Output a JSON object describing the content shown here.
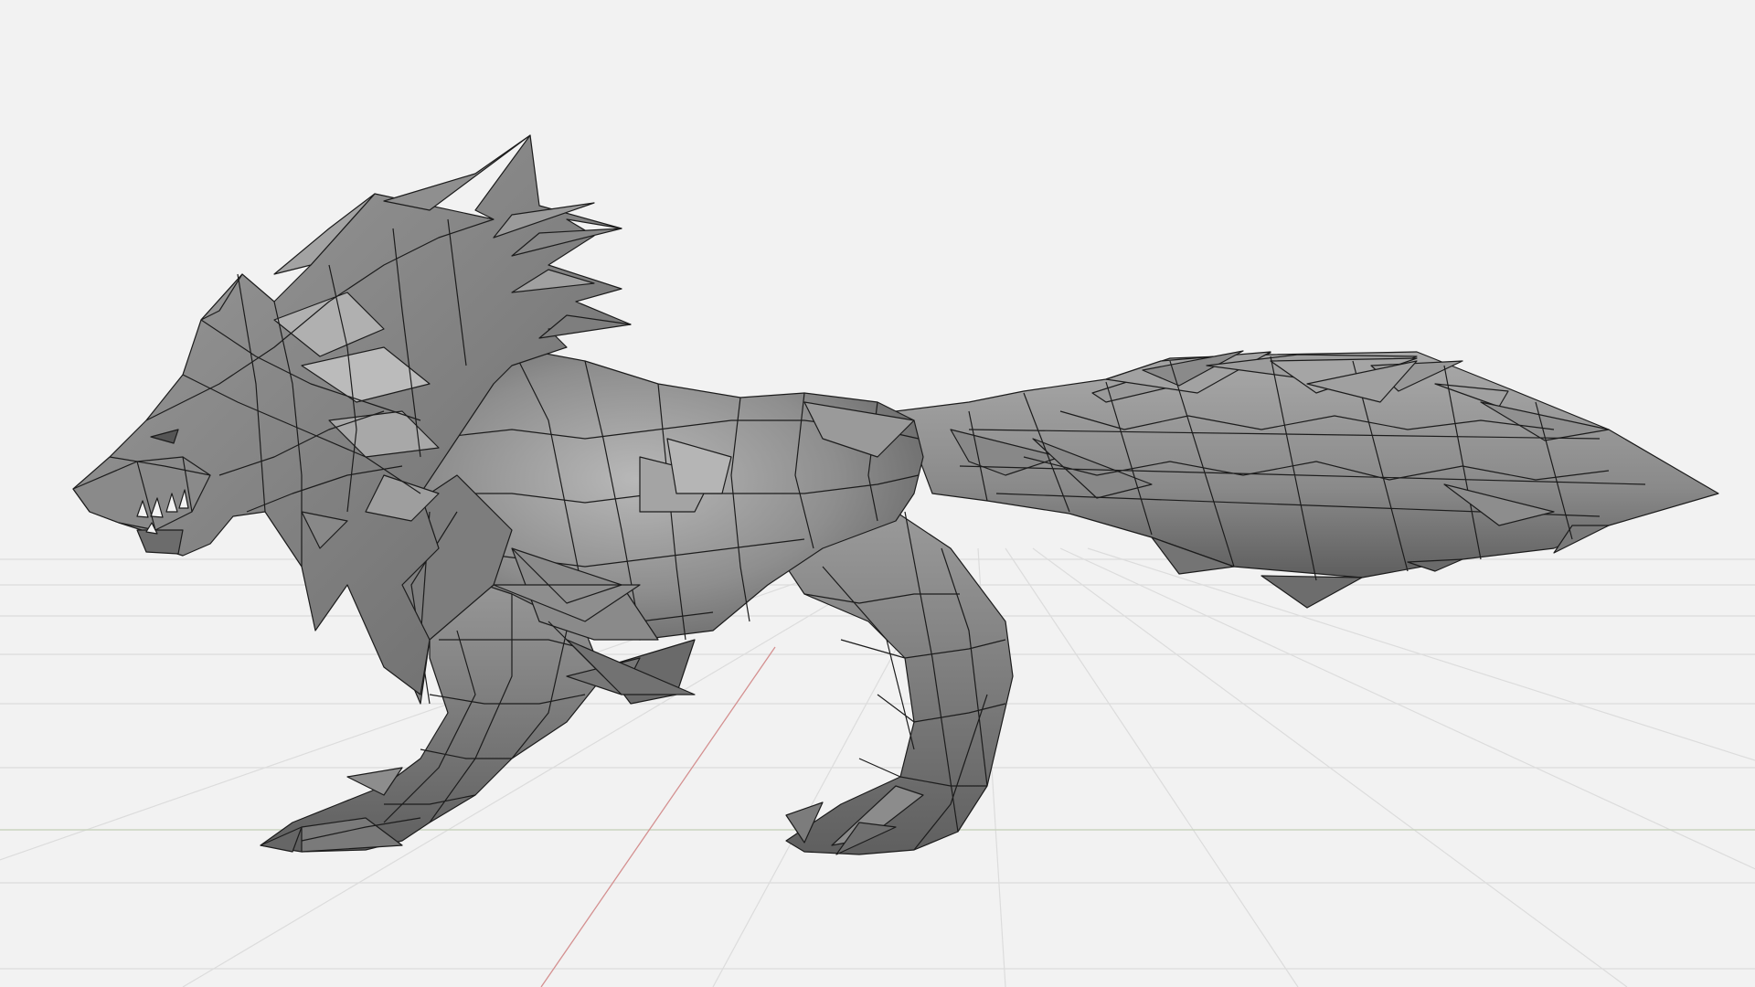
{
  "viewport": {
    "background": "#f2f2f2",
    "grid_color": "#dcdcdc",
    "x_axis_color": "#c9d3bf",
    "y_axis_color": "#d49090"
  },
  "model": {
    "subject": "wolf-model",
    "shading": "solid",
    "wireframe_overlay": true,
    "mesh_fill": "#8f8f8f",
    "edge_color": "#1c1c1c"
  }
}
